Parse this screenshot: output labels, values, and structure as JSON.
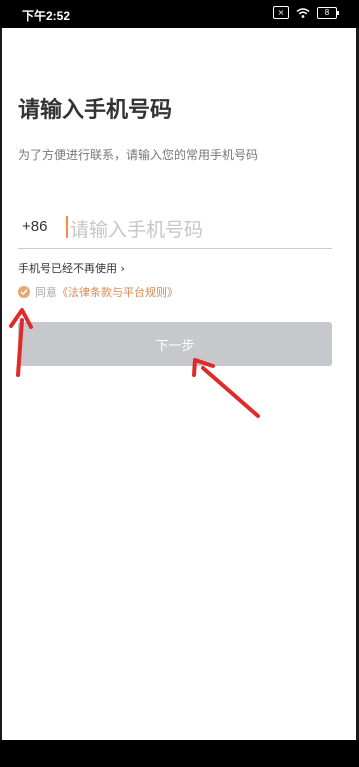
{
  "status_bar": {
    "time": "下午2:52",
    "battery": "8",
    "sim_icon": "sim-x-icon",
    "wifi_icon": "wifi-icon"
  },
  "page": {
    "title": "请输入手机号码",
    "subtitle": "为了方便进行联系，请输入您的常用手机号码"
  },
  "phone": {
    "country_code": "+86",
    "placeholder": "请输入手机号码",
    "value": ""
  },
  "links": {
    "no_longer": "手机号已经不再使用 ›"
  },
  "agreement": {
    "prefix": "同意",
    "terms": "《法律条款与平台规则》"
  },
  "buttons": {
    "next": "下一步"
  },
  "colors": {
    "accent": "#e7a877",
    "terms": "#d98a54",
    "button_disabled": "#c7c8cc",
    "annotation": "#e02a2a"
  }
}
